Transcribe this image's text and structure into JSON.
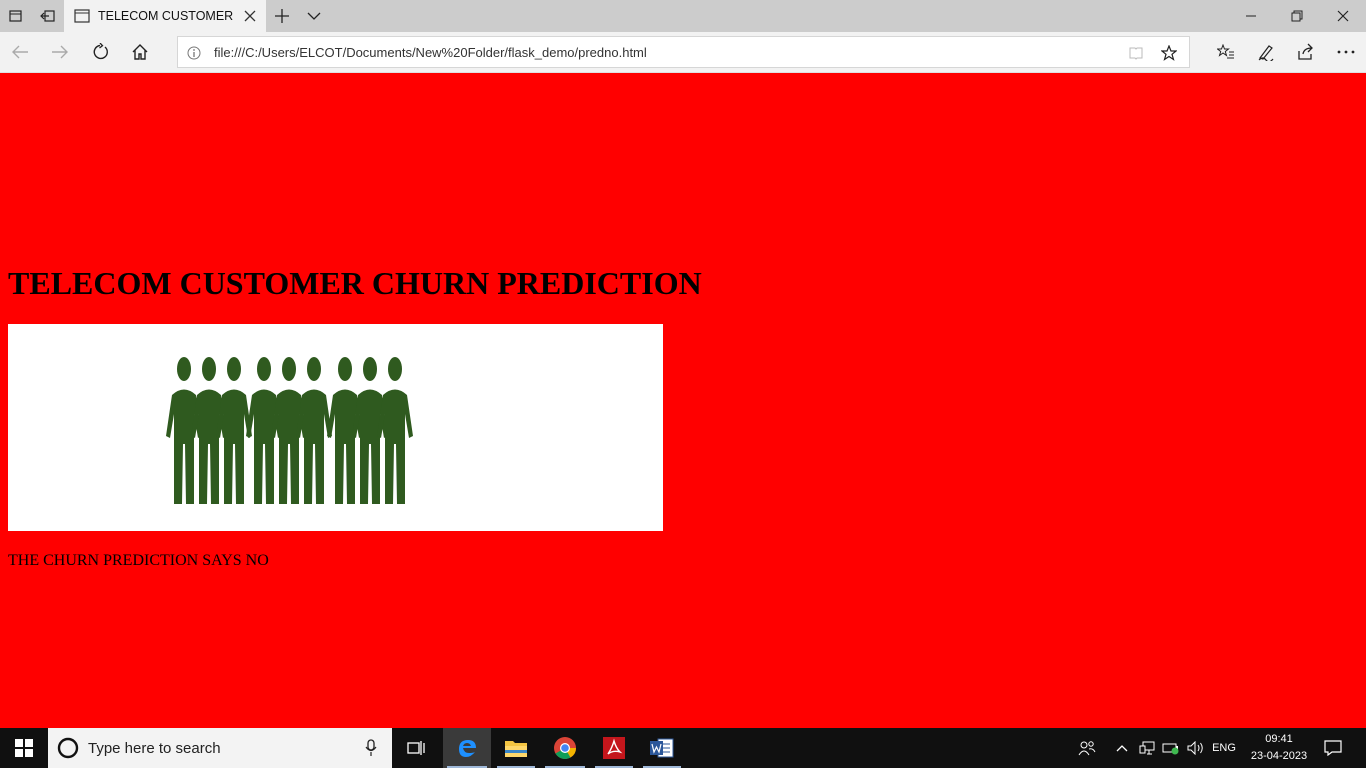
{
  "browser": {
    "tab_title": "TELECOM CUSTOMER C",
    "address": "file:///C:/Users/ELCOT/Documents/New%20Folder/flask_demo/predno.html"
  },
  "page": {
    "title": "TELECOM CUSTOMER CHURN PREDICTION",
    "result_text": "THE CHURN PREDICTION SAYS NO",
    "background_color": "#ff0000",
    "figure_color": "#2f5a1f"
  },
  "taskbar": {
    "search_placeholder": "Type here to search",
    "language": "ENG",
    "time": "09:41",
    "date": "23-04-2023",
    "apps": [
      "task-view",
      "edge",
      "file-explorer",
      "chrome",
      "acrobat",
      "word"
    ]
  }
}
